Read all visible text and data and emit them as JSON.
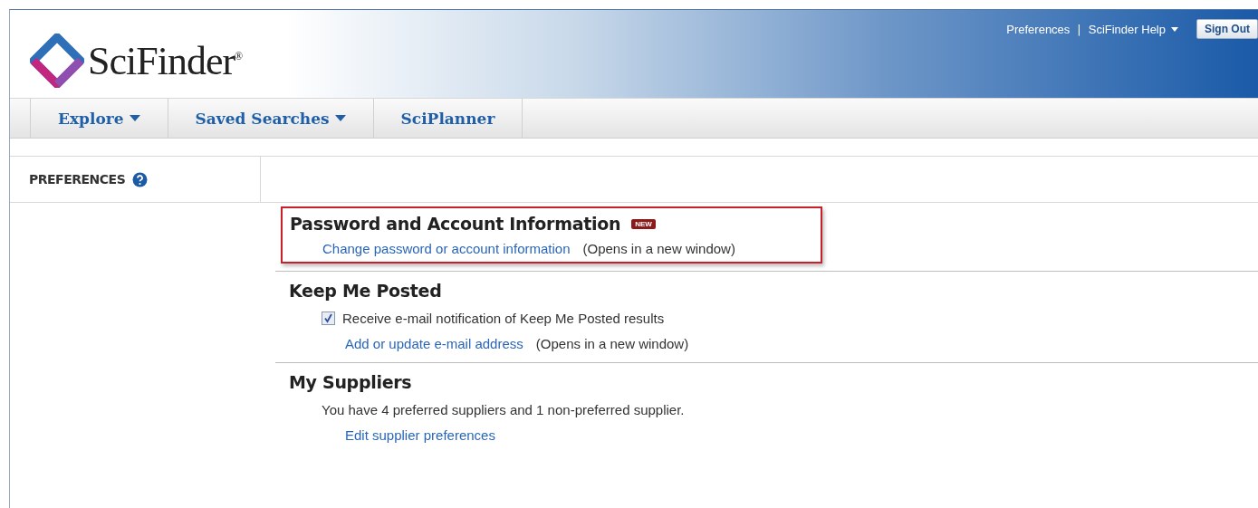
{
  "header": {
    "logo": "SciFinder$^{®}$",
    "links": [
      {
        "label": "Preferences",
        "dropdown": false
      },
      {
        "label": "SciFinder Help",
        "dropdown": true
      }
    ],
    "separator": "|",
    "sign_out": "Sign Out"
  },
  "nav": [
    {
      "label": "Explore",
      "dropdown": true
    },
    {
      "label": "Saved Searches",
      "dropdown": true
    },
    {
      "label": "SciPlanner",
      "dropdown": false
    }
  ],
  "sidebar": {
    "title": "PREFERENCES"
  },
  "sections": [
    {
      "title": "Password and Account Information",
      "badge": "NEW",
      "highlighted": true,
      "items": [
        {
          "kind": "link",
          "label": "Change password or account information",
          "note": "(Opens in a new window)"
        }
      ]
    },
    {
      "title": "Keep Me Posted",
      "highlighted": false,
      "items": [
        {
          "kind": "checkbox",
          "label": "Receive e-mail notification of Keep Me Posted results",
          "checked": true
        },
        {
          "kind": "link",
          "label": "Add or update e-mail address",
          "note": "(Opens in a new window)"
        }
      ]
    },
    {
      "title": "My Suppliers",
      "highlighted": false,
      "items": [
        {
          "kind": "text",
          "label": "You have 4 preferred suppliers and 1 non-preferred supplier."
        },
        {
          "kind": "link",
          "label": "Edit supplier preferences"
        }
      ]
    }
  ]
}
